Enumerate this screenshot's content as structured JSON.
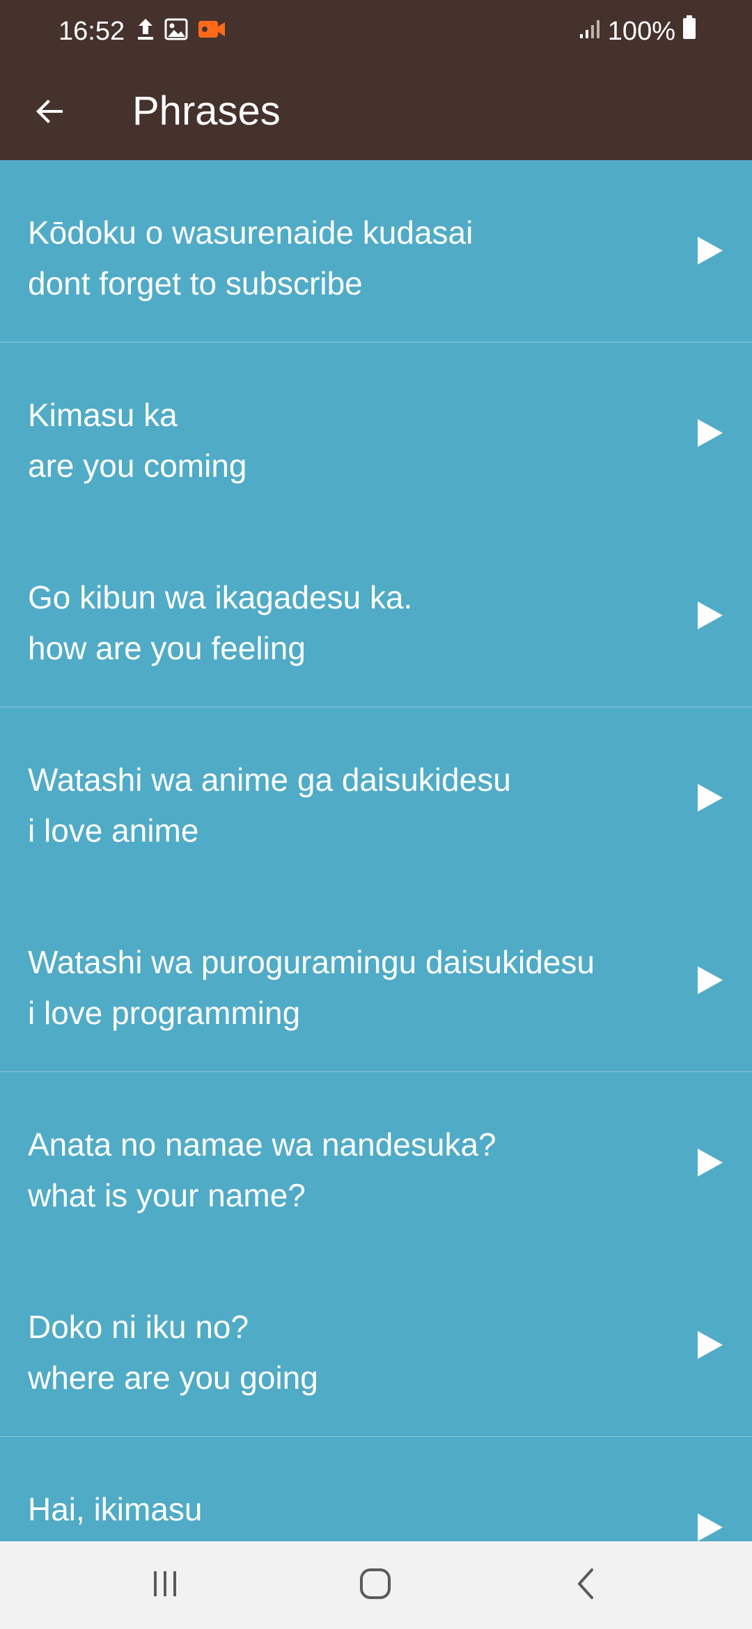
{
  "status_bar": {
    "time": "16:52",
    "battery_text": "100%",
    "icons": [
      "upload-icon",
      "image-icon",
      "video-record-icon",
      "signal-icon",
      "battery-icon"
    ],
    "accent_record_color": "#ff6a1a"
  },
  "app_bar": {
    "title": "Phrases",
    "background_color": "#45322c"
  },
  "list": {
    "background_color": "#50abc7",
    "items": [
      {
        "japanese": "Kōdoku o wasurenaide kudasai",
        "english": "dont forget to subscribe"
      },
      {
        "japanese": "Kimasu ka",
        "english": "are you coming"
      },
      {
        "japanese": "Go kibun wa ikagadesu ka.",
        "english": "how are you feeling"
      },
      {
        "japanese": "Watashi wa anime ga daisukidesu",
        "english": "i love anime"
      },
      {
        "japanese": "Watashi wa puroguramingu daisukidesu",
        "english": "i love programming"
      },
      {
        "japanese": "Anata no namae wa nandesuka?",
        "english": "what is your name?"
      },
      {
        "japanese": "Doko ni iku no?",
        "english": "where are you going"
      },
      {
        "japanese": "Hai, ikimasu",
        "english": ""
      }
    ]
  },
  "nav_bar": {
    "icons": [
      "recent-apps-icon",
      "home-icon",
      "back-nav-icon"
    ]
  }
}
